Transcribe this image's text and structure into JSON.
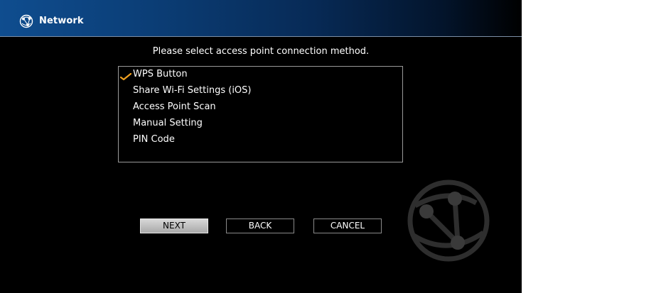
{
  "header": {
    "title": "Network",
    "icon": "network-globe-icon"
  },
  "prompt": "Please select access point connection method.",
  "methods": [
    {
      "label": "WPS Button",
      "selected": true
    },
    {
      "label": "Share Wi-Fi Settings (iOS)",
      "selected": false
    },
    {
      "label": "Access Point Scan",
      "selected": false
    },
    {
      "label": "Manual Setting",
      "selected": false
    },
    {
      "label": "PIN Code",
      "selected": false
    }
  ],
  "buttons": {
    "next": "NEXT",
    "back": "BACK",
    "cancel": "CANCEL"
  },
  "colors": {
    "header": "#0f4d8f",
    "check": "#f0a020",
    "background": "#000000"
  },
  "decor": {
    "watermark": "network-globe-icon"
  }
}
